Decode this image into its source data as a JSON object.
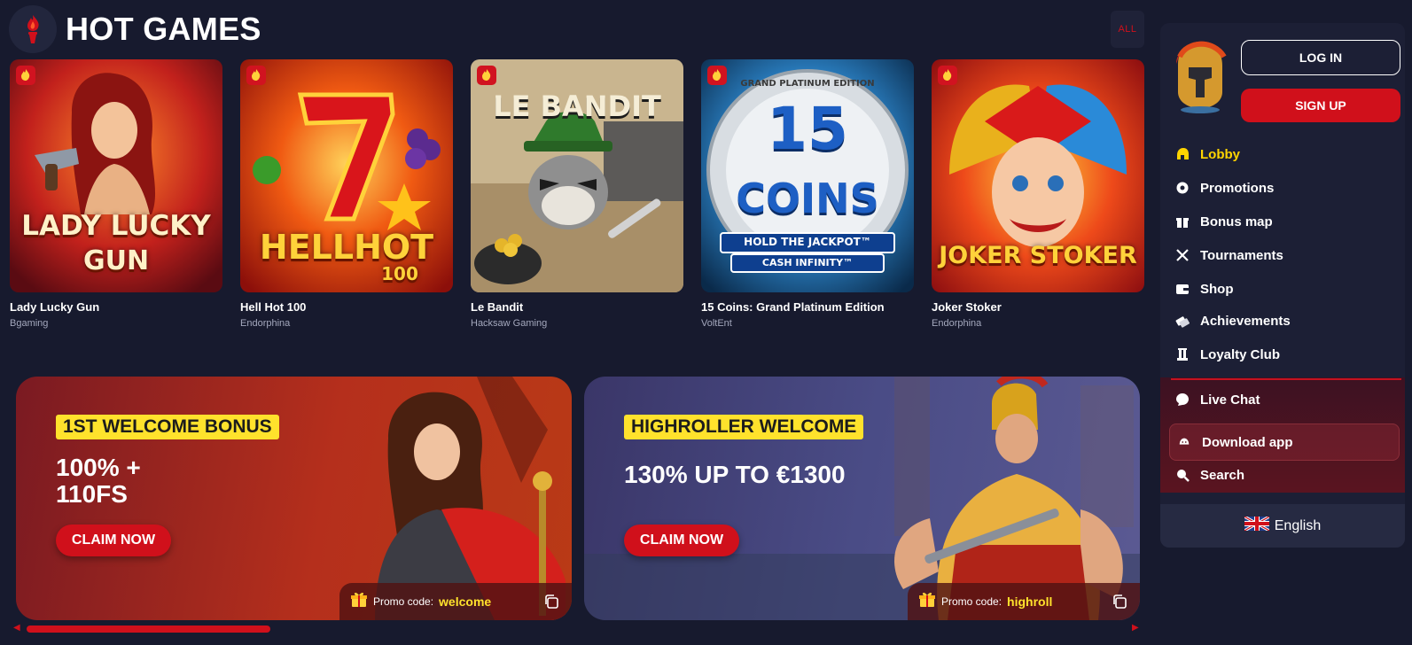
{
  "header": {
    "title": "HOT GAMES",
    "all_label": "ALL",
    "torch_icon": "torch-icon"
  },
  "games": [
    {
      "name": "Lady Lucky Gun",
      "provider": "Bgaming",
      "art_line1": "LADY LUCKY",
      "art_line2": "GUN"
    },
    {
      "name": "Hell Hot 100",
      "provider": "Endorphina",
      "art_line1": "HELLHOT",
      "art_line2": "100"
    },
    {
      "name": "Le Bandit",
      "provider": "Hacksaw Gaming",
      "art_line1": "LE BANDIT",
      "art_line2": ""
    },
    {
      "name": "15 Coins: Grand Platinum Edition",
      "provider": "VoltEnt",
      "art_line1": "15",
      "art_line2": "COINS",
      "art_line3": "GRAND PLATINUM EDITION",
      "art_line4": "HOLD THE JACKPOT™",
      "art_line5": "CASH INFINITY™"
    },
    {
      "name": "Joker Stoker",
      "provider": "Endorphina",
      "art_line1": "JOKER STOKER",
      "art_line2": ""
    }
  ],
  "banners": [
    {
      "tag": "1ST WELCOME BONUS",
      "amount": "100% +\n110FS",
      "cta": "CLAIM NOW",
      "promo_label": "Promo code:",
      "promo_code": "welcome"
    },
    {
      "tag": "HIGHROLLER WELCOME",
      "amount": "130% UP TO €1300",
      "cta": "CLAIM NOW",
      "promo_label": "Promo code:",
      "promo_code": "highroll"
    }
  ],
  "carousel": {
    "progress_fraction": 0.22
  },
  "sidebar": {
    "login_label": "LOG IN",
    "signup_label": "SIGN UP",
    "menu": [
      {
        "label": "Lobby",
        "icon": "helmet-icon",
        "active": true
      },
      {
        "label": "Promotions",
        "icon": "badge-icon"
      },
      {
        "label": "Bonus map",
        "icon": "gift-box-icon"
      },
      {
        "label": "Tournaments",
        "icon": "crossed-swords-icon"
      },
      {
        "label": "Shop",
        "icon": "wallet-icon"
      },
      {
        "label": "Achievements",
        "icon": "tickets-icon"
      },
      {
        "label": "Loyalty Club",
        "icon": "pillar-icon"
      }
    ],
    "live_chat": "Live Chat",
    "download_app": "Download app",
    "search": "Search",
    "language": "English"
  },
  "colors": {
    "accent_red": "#d0101b",
    "active_yellow": "#ffd400",
    "promo_yellow": "#ffe22c",
    "background": "#171a2e"
  }
}
